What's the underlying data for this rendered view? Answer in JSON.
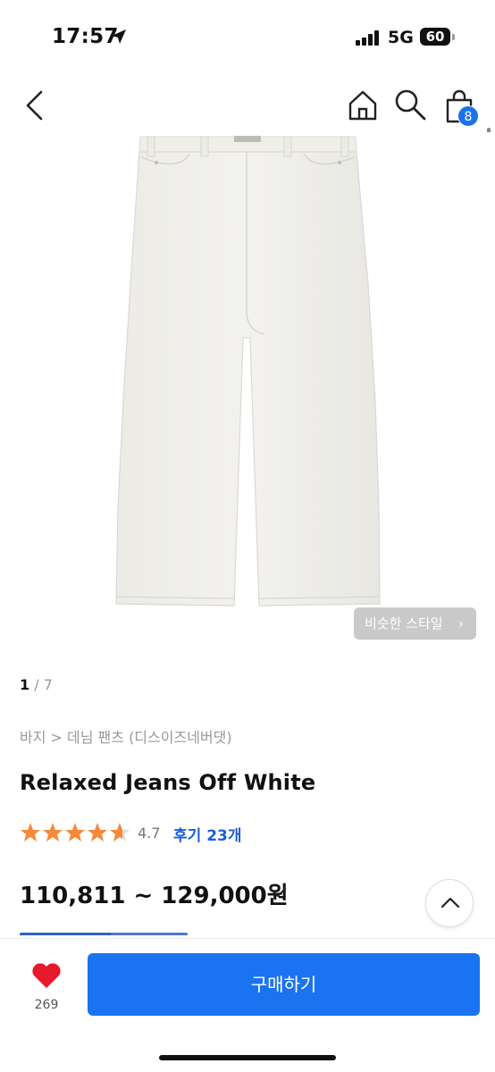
{
  "status_bar": {
    "time": "17:57",
    "network": "5G",
    "battery": "60"
  },
  "nav": {
    "cart_count": "8",
    "icons": [
      "back-arrow-icon",
      "home-icon",
      "search-icon",
      "shopping-bag-icon"
    ]
  },
  "gallery": {
    "current": "1",
    "separator": "/",
    "total": "7",
    "similar_style_label": "비슷한 스타일"
  },
  "product": {
    "breadcrumb": "바지 > 데님 팬츠 (디스이즈네버댓)",
    "title": "Relaxed Jeans Off White",
    "rating": "4.7",
    "review_label": "후기 23개",
    "price": "110,811 ~ 129,000원"
  },
  "bottom_bar": {
    "like_count": "269",
    "buy_label": "구매하기"
  },
  "colors": {
    "accent": "#1a73f0",
    "star": "#f58a3a",
    "badge": "#1a73e8",
    "link": "#1a5fd6"
  }
}
